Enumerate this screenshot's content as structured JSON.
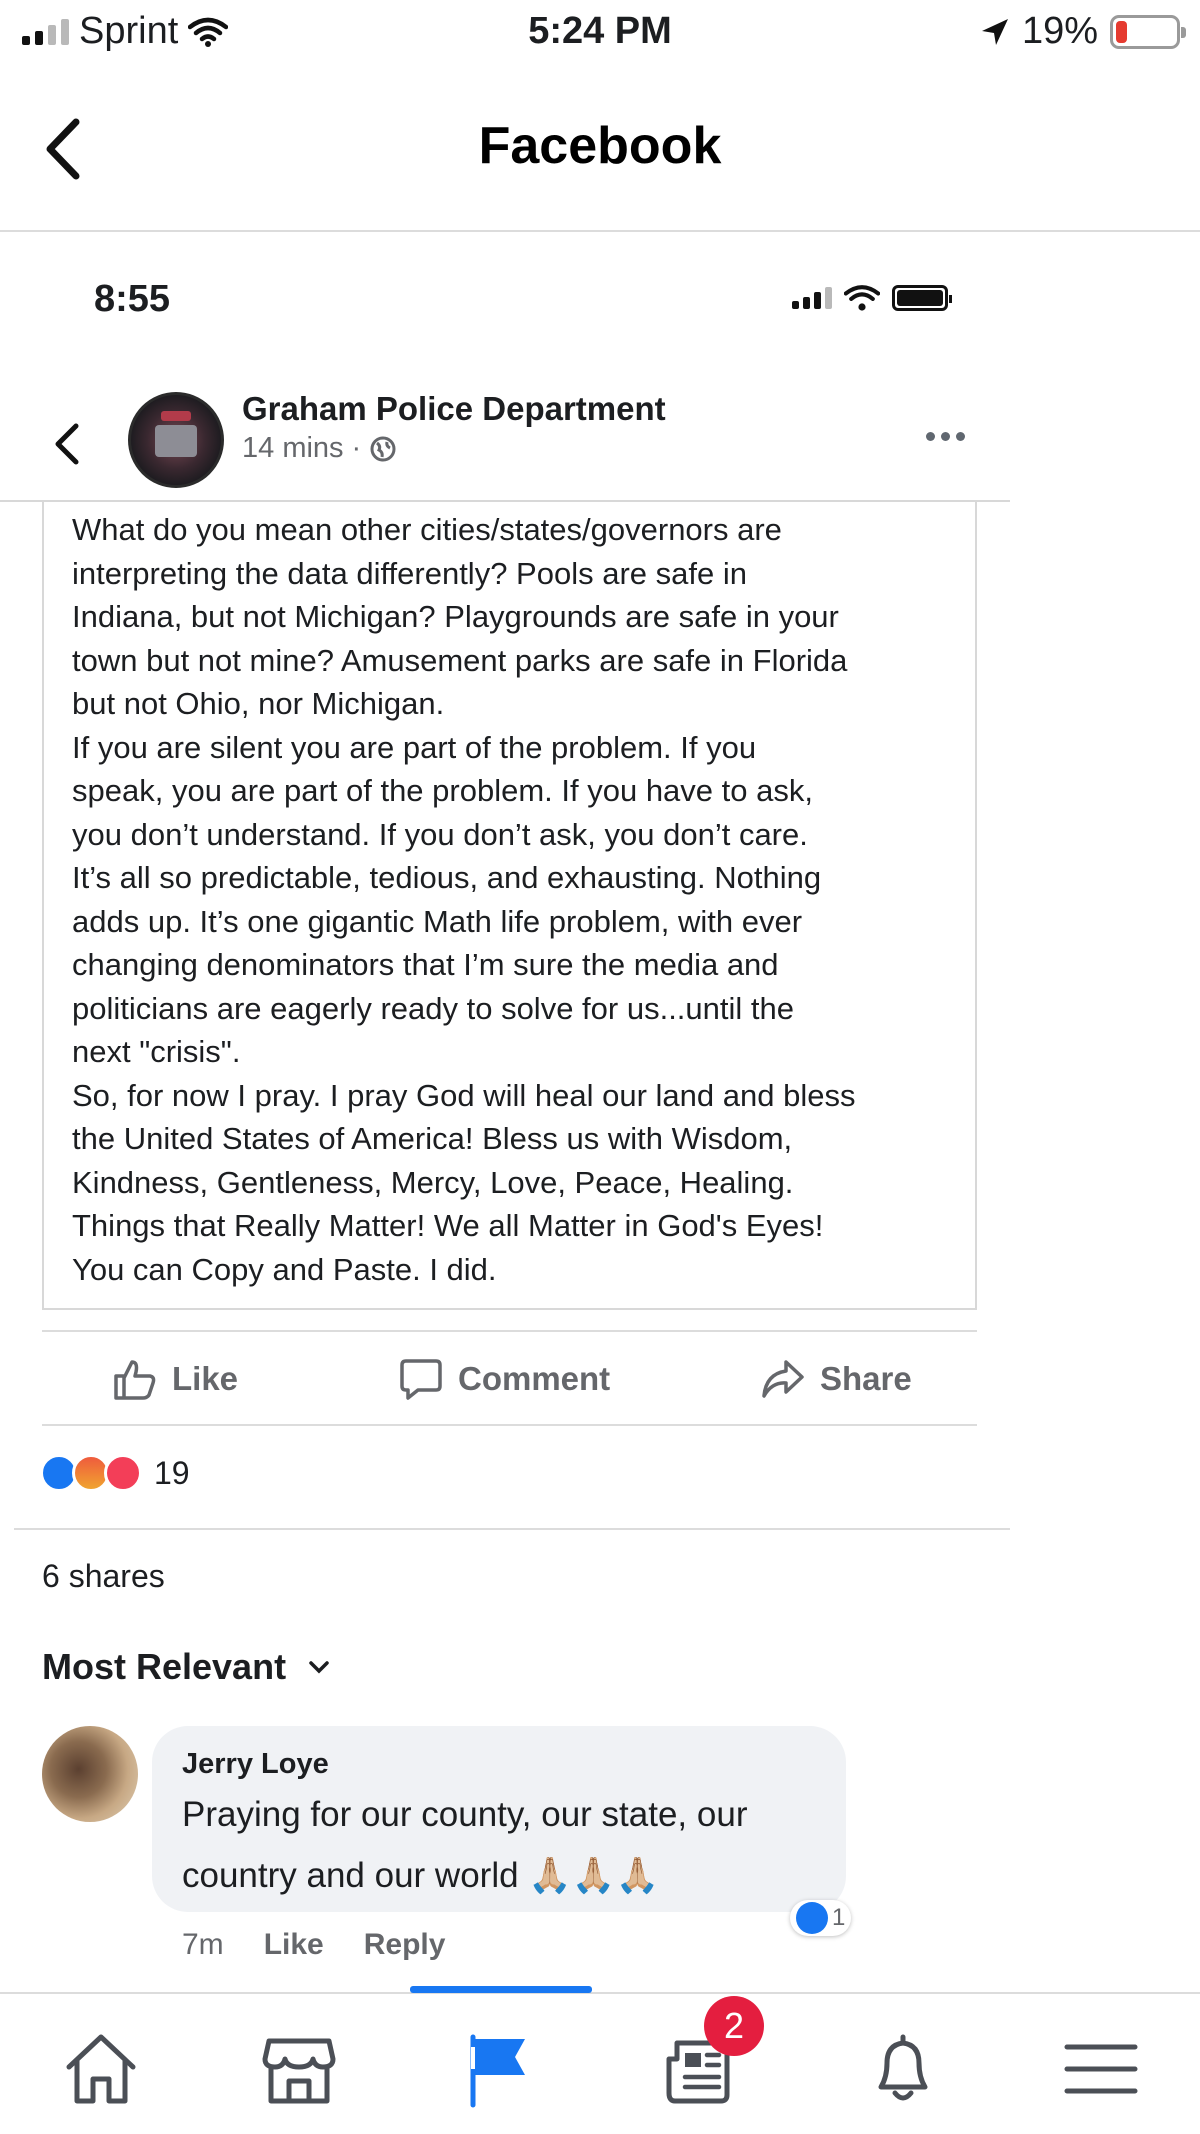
{
  "status_bar": {
    "carrier": "Sprint",
    "time": "5:24 PM",
    "battery": "19%",
    "battery_level": 0.19
  },
  "nav": {
    "title": "Facebook",
    "back_icon": "chevron-left-icon"
  },
  "inner_status_bar": {
    "time": "8:55"
  },
  "post": {
    "author": "Graham Police Department",
    "time": "14 mins",
    "separator": "·",
    "audience_icon": "globe-icon",
    "text": "What do you mean other cities/states/governors are\ninterpreting the data differently? Pools are safe in\nIndiana, but not Michigan? Playgrounds are safe in your\ntown but not mine? Amusement parks are safe in Florida\nbut not Ohio, nor Michigan.\nIf you are silent you are part of the problem. If you\nspeak, you are part of the problem. If you have to ask,\nyou don’t understand. If you don’t ask, you don’t care.\nIt’s all so predictable, tedious, and exhausting. Nothing\nadds up. It’s one gigantic Math life problem, with ever\nchanging denominators that I’m sure the media and\npoliticians are eagerly ready to solve for us...until the\nnext \"crisis\".\nSo, for now I pray. I pray God will heal our land and bless\nthe United States of America! Bless us with Wisdom,\nKindness, Gentleness, Mercy, Love, Peace, Healing.\nThings that Really Matter! We all Matter in God's Eyes!\nYou can Copy and Paste. I did."
  },
  "actions": {
    "like": "Like",
    "comment": "Comment",
    "share": "Share"
  },
  "reactions": {
    "types": [
      "like",
      "angry",
      "love"
    ],
    "count": "19"
  },
  "shares": "6 shares",
  "sort_label": "Most Relevant",
  "comments": [
    {
      "author": "Jerry Loye",
      "text": "Praying for our county, our state, our country and our world 🙏🏼🙏🏼🙏🏼",
      "time": "7m",
      "like_label": "Like",
      "reply_label": "Reply",
      "like_count": "1"
    }
  ],
  "tabbar": {
    "tabs": [
      "home-icon",
      "marketplace-icon",
      "pages-flag-icon",
      "news-icon",
      "notifications-icon",
      "menu-icon"
    ],
    "active": "pages-flag-icon",
    "news_badge": "2",
    "colors": {
      "active": "#1877f2",
      "badge": "#e41e3f"
    }
  }
}
